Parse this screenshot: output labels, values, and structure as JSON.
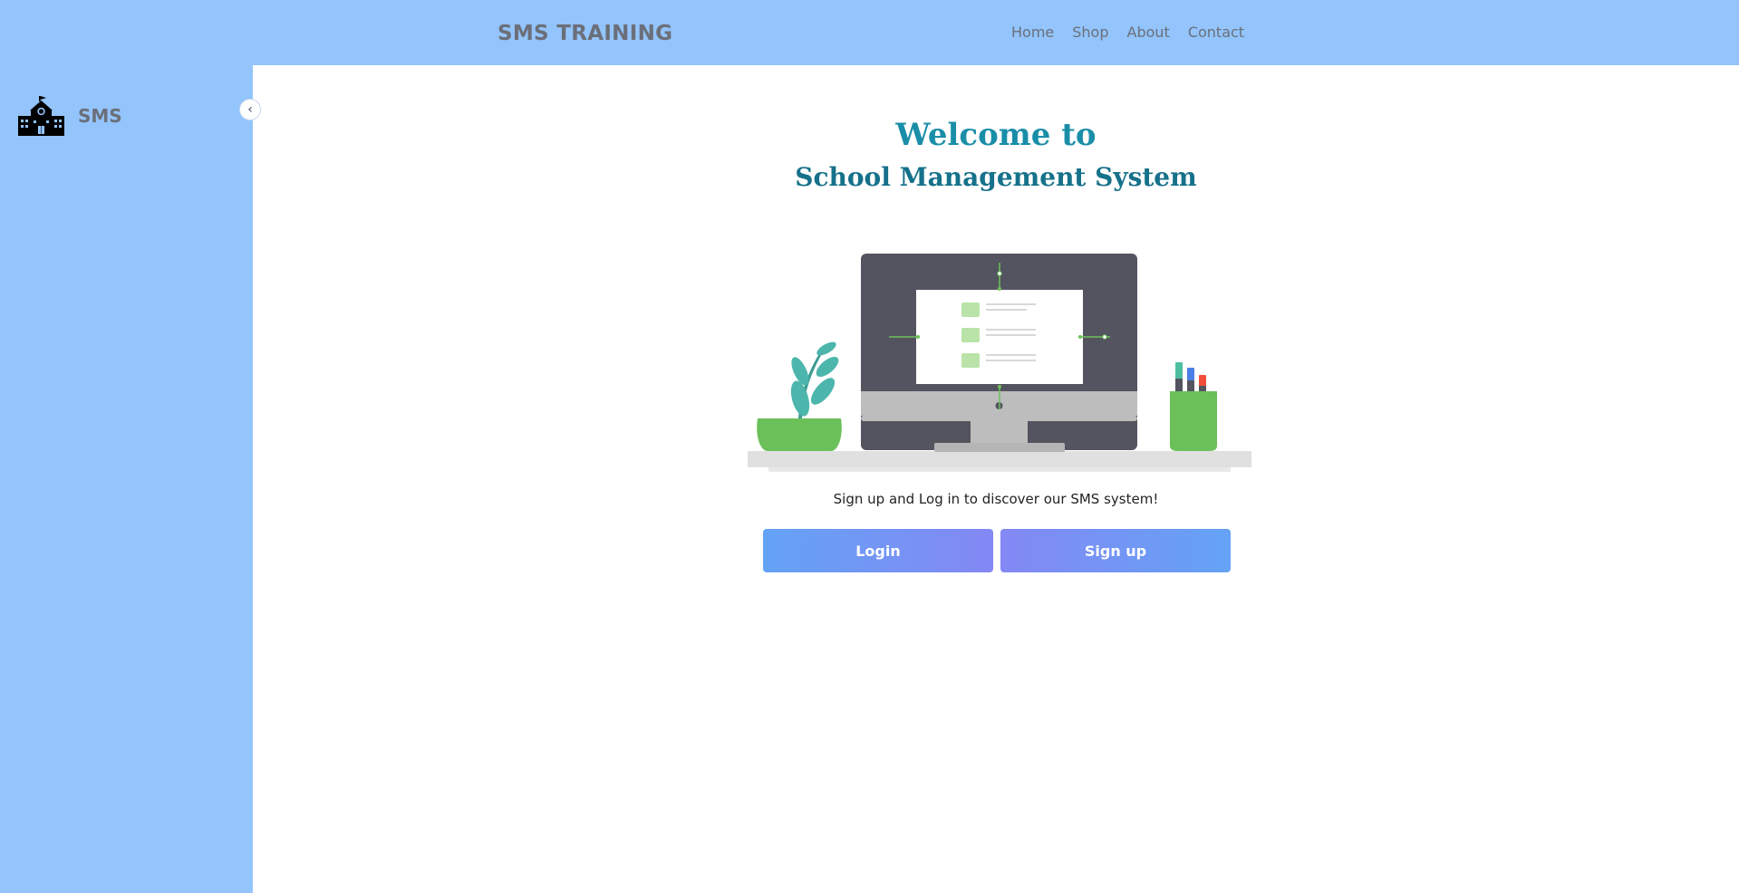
{
  "navbar": {
    "brand": "SMS TRAINING",
    "links": [
      {
        "label": "Home"
      },
      {
        "label": "Shop"
      },
      {
        "label": "About"
      },
      {
        "label": "Contact"
      }
    ]
  },
  "sidebar": {
    "logo_icon": "school-icon",
    "label": "SMS",
    "collapse_icon": "chevron-left-icon",
    "collapse_glyph": "‹"
  },
  "main": {
    "title_line1": "Welcome to",
    "title_line2": "School Management System",
    "illustration": "desk-computer-illustration",
    "tagline": "Sign up and Log in to discover our SMS system!",
    "login_label": "Login",
    "signup_label": "Sign up"
  },
  "colors": {
    "background": "#93c4fc",
    "content": "#ffffff",
    "title": "#1a8ea8",
    "button_start": "#64a3f6",
    "button_end": "#8388f4"
  }
}
